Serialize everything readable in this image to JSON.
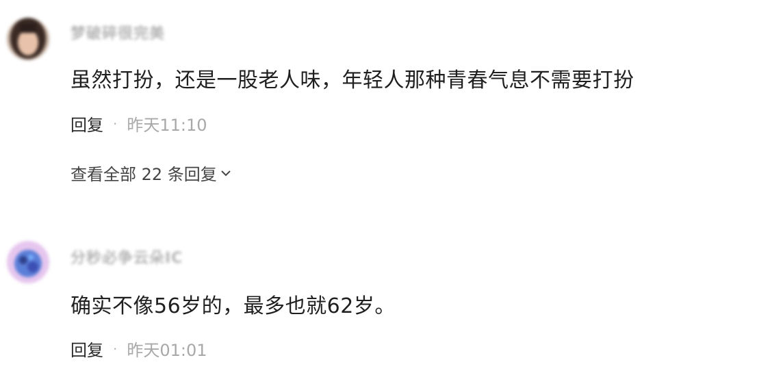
{
  "comments": [
    {
      "username": "梦破碎很完美",
      "content": "虽然打扮，还是一股老人味，年轻人那种青春气息不需要打扮",
      "reply_label": "回复",
      "separator": "·",
      "time": "昨天11:10",
      "view_replies": "查看全部 22 条回复"
    },
    {
      "username": "分秒必争云朵IC",
      "content": "确实不像56岁的，最多也就62岁。",
      "reply_label": "回复",
      "separator": "·",
      "time": "昨天01:01"
    }
  ]
}
